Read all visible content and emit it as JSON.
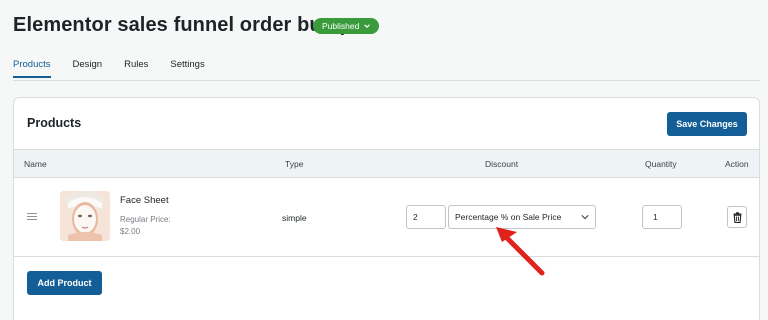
{
  "header": {
    "title": "Elementor sales funnel order bump",
    "status_badge": "Published"
  },
  "tabs": [
    {
      "label": "Products",
      "active": true
    },
    {
      "label": "Design",
      "active": false
    },
    {
      "label": "Rules",
      "active": false
    },
    {
      "label": "Settings",
      "active": false
    }
  ],
  "card": {
    "title": "Products",
    "save_label": "Save Changes",
    "add_label": "Add Product"
  },
  "table": {
    "columns": [
      "Name",
      "Type",
      "Discount",
      "Quantity",
      "Action"
    ],
    "rows": [
      {
        "name": "Face Sheet",
        "price_label": "Regular Price:",
        "price_value": "$2.00",
        "type": "simple",
        "discount_value": "2",
        "discount_type": "Percentage % on Sale Price",
        "quantity": "1"
      }
    ]
  },
  "icons": {
    "status": "chevron-down-icon",
    "select": "chevron-down-icon",
    "drag": "drag-handle-icon",
    "delete": "trash-icon",
    "annotation": "red-arrow-annotation"
  },
  "colors": {
    "primary": "#135e96",
    "published": "#3a9b3d",
    "annotation": "#e0211c"
  }
}
